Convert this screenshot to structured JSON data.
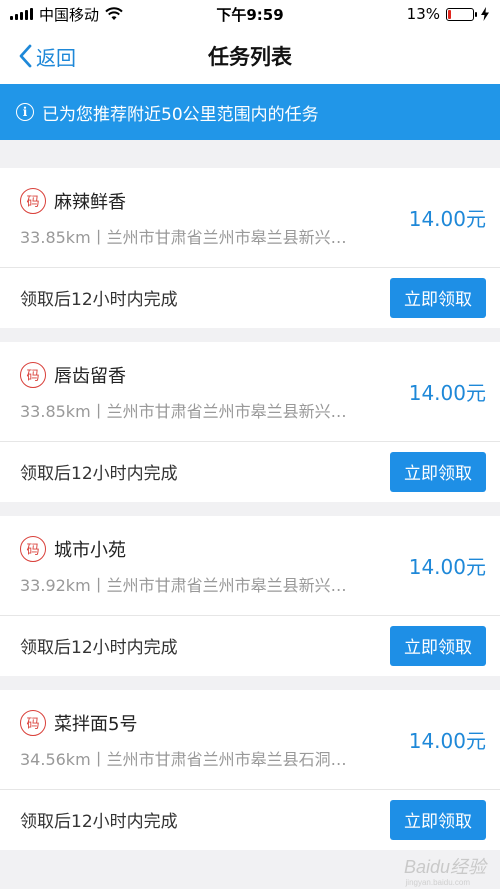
{
  "status_bar": {
    "carrier": "中国移动",
    "time": "下午9:59",
    "battery_percent": "13%",
    "battery_level": 0.13,
    "battery_color": "#e0271f"
  },
  "nav": {
    "back_label": "返回",
    "title": "任务列表"
  },
  "banner": {
    "icon": "info-icon",
    "icon_glyph": "i",
    "text": "已为您推荐附近50公里范围内的任务"
  },
  "tasks": [
    {
      "code_icon_text": "码",
      "name": "麻辣鲜香",
      "address": "33.85km丨兰州市甘肃省兰州市皋兰县新兴…",
      "price": "14.00元",
      "deadline": "领取后12小时内完成",
      "button_label": "立即领取"
    },
    {
      "code_icon_text": "码",
      "name": "唇齿留香",
      "address": "33.85km丨兰州市甘肃省兰州市皋兰县新兴…",
      "price": "14.00元",
      "deadline": "领取后12小时内完成",
      "button_label": "立即领取"
    },
    {
      "code_icon_text": "码",
      "name": "城市小苑",
      "address": "33.92km丨兰州市甘肃省兰州市皋兰县新兴…",
      "price": "14.00元",
      "deadline": "领取后12小时内完成",
      "button_label": "立即领取"
    },
    {
      "code_icon_text": "码",
      "name": "菜拌面5号",
      "address": "34.56km丨兰州市甘肃省兰州市皋兰县石洞…",
      "price": "14.00元",
      "deadline": "领取后12小时内完成",
      "button_label": "立即领取"
    }
  ],
  "watermark": {
    "text": "Baidu经验",
    "sub": "jingyan.baidu.com"
  },
  "colors": {
    "accent": "#1e88d8",
    "banner_bg": "#2196e8",
    "button_bg": "#1e8fe6",
    "code_icon": "#d9403a",
    "page_bg": "#f1f1f3"
  }
}
